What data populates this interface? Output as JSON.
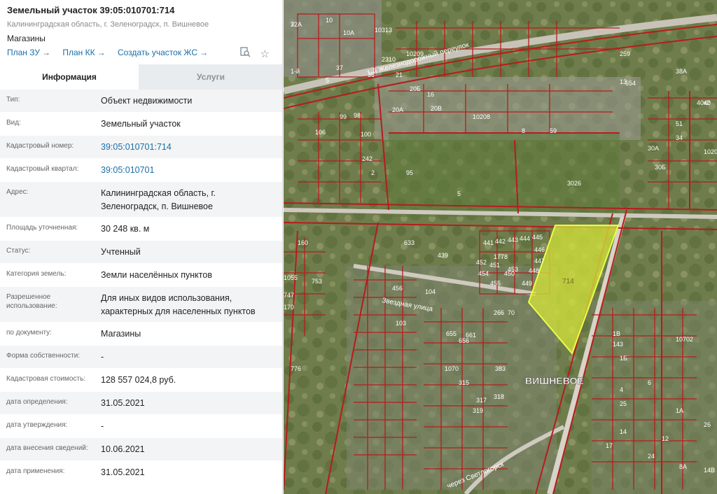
{
  "header": {
    "title": "Земельный участок 39:05:010701:714",
    "address": "Калининградская область, г. Зеленоградск, п. Вишневое",
    "purpose": "Магазины",
    "links": [
      {
        "label": "План ЗУ",
        "arrow": "→"
      },
      {
        "label": "План КК",
        "arrow": "→"
      },
      {
        "label": "Создать участок ЖС",
        "arrow": "→"
      }
    ],
    "icons": [
      "search-document-icon",
      "star-icon"
    ]
  },
  "tabs": [
    {
      "label": "Информация",
      "active": true
    },
    {
      "label": "Услуги",
      "active": false
    }
  ],
  "info_rows": [
    {
      "label": "Тип:",
      "value": "Объект недвижимости"
    },
    {
      "label": "Вид:",
      "value": "Земельный участок"
    },
    {
      "label": "Кадастровый номер:",
      "value": "39:05:010701:714",
      "link": true
    },
    {
      "label": "Кадастровый квартал:",
      "value": "39:05:010701",
      "link": true
    },
    {
      "label": "Адрес:",
      "value": "Калининградская область, г. Зеленоградск, п. Вишневое"
    },
    {
      "label": "Площадь уточненная:",
      "value": "30 248 кв. м"
    },
    {
      "label": "Статус:",
      "value": "Учтенный"
    },
    {
      "label": "Категория земель:",
      "value": "Земли населённых пунктов"
    },
    {
      "label": "Разрешенное использование:",
      "value": "Для иных видов использования, характерных для населенных пунктов"
    },
    {
      "label": "по документу:",
      "value": "Магазины"
    },
    {
      "label": "Форма собственности:",
      "value": "-"
    },
    {
      "label": "Кадастровая стоимость:",
      "value": "128 557 024,8 руб."
    },
    {
      "label": "дата определения:",
      "value": "31.05.2021"
    },
    {
      "label": "дата утверждения:",
      "value": "-"
    },
    {
      "label": "дата внесения сведений:",
      "value": "10.06.2021"
    },
    {
      "label": "дата применения:",
      "value": "31.05.2021"
    }
  ],
  "map": {
    "selected_parcel_label": "714",
    "settlement_label": "ВИШНЕВОЕ",
    "street_labels": [
      "1-й Железнодорожный переулок",
      "Звездная улица",
      "через Светлогорск"
    ],
    "parcel_labels": [
      "32А",
      "10",
      "10А",
      "10313",
      "10209",
      "2310",
      "1-й",
      "5",
      "37",
      "36",
      "21",
      "20Б",
      "16",
      "20В",
      "10208",
      "8",
      "59",
      "20А",
      "99",
      "98",
      "100",
      "106",
      "242",
      "2",
      "95",
      "5",
      "3026",
      "633",
      "1778",
      "439",
      "441",
      "442",
      "443",
      "444",
      "445",
      "446",
      "447",
      "448",
      "449",
      "450",
      "451",
      "452",
      "453",
      "454",
      "455",
      "456",
      "104",
      "103",
      "266",
      "70",
      "661",
      "656",
      "655",
      "383",
      "315",
      "317",
      "318",
      "319",
      "776",
      "1070",
      "10702",
      "6",
      "13",
      "40",
      "51",
      "10206",
      "30Б",
      "259",
      "654",
      "38А",
      "40к2",
      "34",
      "30А",
      "4",
      "25",
      "160",
      "1055",
      "753",
      "747",
      "170",
      "143",
      "1В",
      "1Б",
      "1А",
      "8А",
      "14В",
      "14",
      "24",
      "26",
      "12",
      "17",
      "7"
    ],
    "colors": {
      "boundary": "#b71c1c",
      "selected_fill": "#d6e63a",
      "label": "#ffffff"
    }
  }
}
